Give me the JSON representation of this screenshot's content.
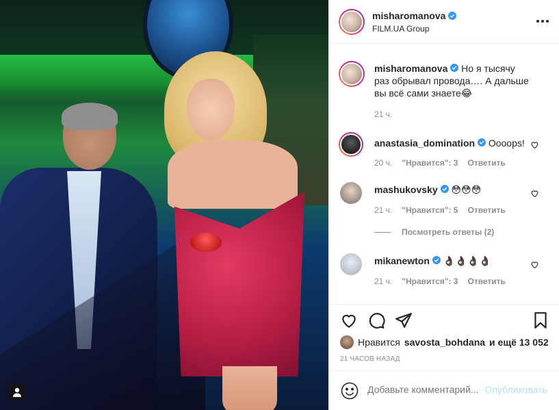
{
  "post": {
    "author": "misharomanova",
    "location": "FILM.UA Group",
    "caption": "Но я тысячу раз обрывал провода…. А дальше вы всё сами знаете😂",
    "caption_time": "21 ч.",
    "likes_prefix": "Нравится",
    "likes_user": "savosta_bohdana",
    "likes_suffix": "и ещё 13 052",
    "timestamp": "21 ЧАСОВ НАЗАД"
  },
  "comments": [
    {
      "user": "anastasia_domination",
      "verified": true,
      "text": "Oooops!",
      "time": "20 ч.",
      "likes": "\"Нравится\": 3",
      "reply": "Ответить"
    },
    {
      "user": "mashukovsky",
      "verified": true,
      "text": "😳😳😳",
      "time": "21 ч.",
      "likes": "\"Нравится\": 5",
      "reply": "Ответить"
    },
    {
      "user": "mikanewton",
      "verified": true,
      "text": "👌🏿👌🏿👌🏿👌🏿",
      "time": "21 ч.",
      "likes": "\"Нравится\": 3",
      "reply": "Ответить"
    }
  ],
  "view_replies": "Посмотреть ответы (2)",
  "composer": {
    "placeholder": "Добавьте комментарий...",
    "post_label": "Опубликовать"
  },
  "icons": {
    "more": "more-horizontal-icon",
    "verified": "verified-badge-icon",
    "heart": "heart-icon",
    "comment": "comment-icon",
    "share": "share-icon",
    "save": "bookmark-icon",
    "emoji": "emoji-icon",
    "user_tag": "user-tag-icon"
  },
  "colors": {
    "verified": "#3897f0",
    "post_disabled": "#b2dffc",
    "muted": "#8e8e8e",
    "text": "#262626"
  }
}
